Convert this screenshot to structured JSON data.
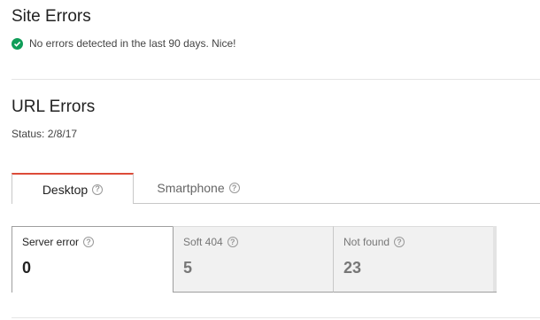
{
  "site_errors": {
    "title": "Site Errors",
    "status_text": "No errors detected in the last 90 days. Nice!",
    "status_icon": "check-circle-icon",
    "status_color": "#0f9d58"
  },
  "url_errors": {
    "title": "URL Errors",
    "status": "Status: 2/8/17"
  },
  "tabs": [
    {
      "label": "Desktop",
      "active": true
    },
    {
      "label": "Smartphone",
      "active": false
    }
  ],
  "metrics": [
    {
      "label": "Server error",
      "value": "0",
      "selected": true
    },
    {
      "label": "Soft 404",
      "value": "5",
      "selected": false
    },
    {
      "label": "Not found",
      "value": "23",
      "selected": false
    }
  ],
  "colors": {
    "active_tab_accent": "#dd4b39",
    "success_icon": "#0f9d58"
  }
}
